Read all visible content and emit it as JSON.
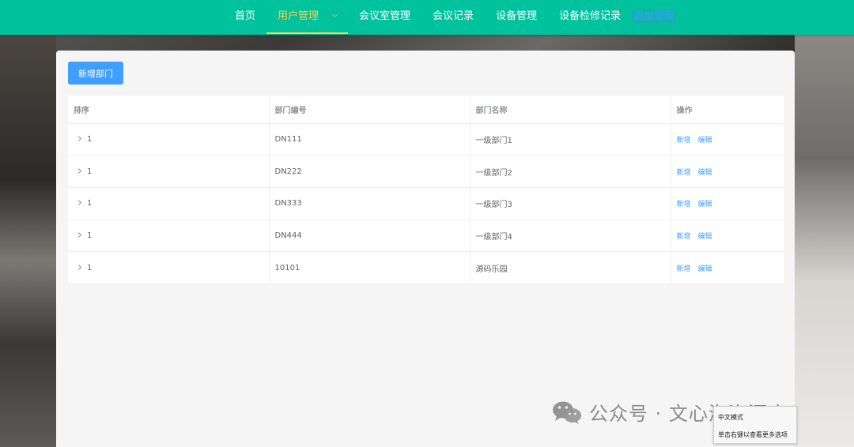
{
  "nav": {
    "items": [
      {
        "label": "首页",
        "active": false
      },
      {
        "label": "用户管理",
        "active": true
      },
      {
        "label": "会议室管理",
        "active": false
      },
      {
        "label": "会议记录",
        "active": false
      },
      {
        "label": "设备管理",
        "active": false
      },
      {
        "label": "设备检修记录",
        "active": false
      }
    ],
    "logout_label": "退出登录",
    "bar_color": "#00c29d",
    "active_color": "#ffd04b"
  },
  "toolbar": {
    "add_label": "新增部门",
    "button_color": "#409eff"
  },
  "table": {
    "headers": [
      "排序",
      "部门编号",
      "部门名称",
      "操作"
    ],
    "rows": [
      {
        "order": "1",
        "code": "DN111",
        "name": "一级部门1",
        "ops": [
          "新增",
          "编辑"
        ]
      },
      {
        "order": "1",
        "code": "DN222",
        "name": "一级部门2",
        "ops": [
          "新增",
          "编辑"
        ]
      },
      {
        "order": "1",
        "code": "DN333",
        "name": "一级部门3",
        "ops": [
          "新增",
          "编辑"
        ]
      },
      {
        "order": "1",
        "code": "DN444",
        "name": "一级部门4",
        "ops": [
          "新增",
          "编辑"
        ]
      },
      {
        "order": "1",
        "code": "10101",
        "name": "源码乐园",
        "ops": [
          "新增",
          "编辑"
        ]
      }
    ]
  },
  "watermark": {
    "text": "公众号 · 文心海资源库",
    "icon": "wechat-icon"
  },
  "ime_popup": {
    "line1": "中文模式",
    "line2": "单击右键以查看更多选项"
  }
}
